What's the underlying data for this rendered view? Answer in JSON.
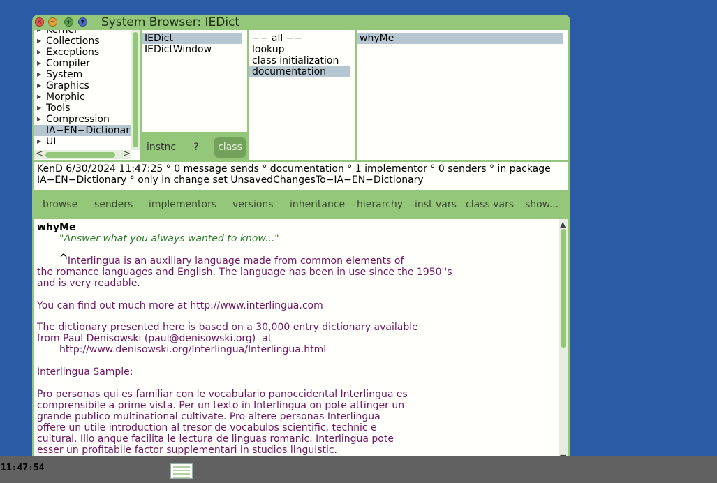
{
  "window": {
    "title": "System Browser: IEDict",
    "controls": {
      "close": "×",
      "minimize": "−",
      "maximize": "+",
      "menu": "▾"
    }
  },
  "categories": {
    "partial_top": "Kernel",
    "items": [
      "Collections",
      "Exceptions",
      "Compiler",
      "System",
      "Graphics",
      "Morphic",
      "Tools",
      "Compression",
      "IA−EN−Dictionary",
      "UI"
    ],
    "selected": "IA−EN−Dictionary"
  },
  "classes": {
    "items": [
      "IEDict",
      "IEDictWindow"
    ],
    "selected": "IEDict",
    "buttons": {
      "instance": "instnc",
      "help": "?",
      "class": "class"
    }
  },
  "protocols": {
    "items": [
      "−− all −−",
      "lookup",
      "class initialization",
      "documentation"
    ],
    "selected": "documentation"
  },
  "methods": {
    "items": [
      "whyMe"
    ],
    "selected": "whyMe"
  },
  "info": {
    "line1": "KenD 6/30/2024 11:47:25 ° 0 message sends ° documentation ° 1 implementor ° 0 senders ° in package",
    "line2": "IA−EN−Dictionary ° only in change set UnsavedChangesTo−IA−EN−Dictionary"
  },
  "toolbar": {
    "browse": "browse",
    "senders": "senders",
    "implementors": "implementors",
    "versions": "versions",
    "inheritance": "inheritance",
    "hierarchy": "hierarchy",
    "inst_vars": "inst vars",
    "class_vars": "class vars",
    "show": "show..."
  },
  "code": {
    "header": "whyMe",
    "comment": "\"Answer what you always wanted to know...\"",
    "caret": "^",
    "l1": "'Interlingua is an auxiliary language made from common elements of",
    "l2": "the romance languages and English. The language has been in use since the 1950''s",
    "l3": "and is very readable.",
    "l4": "You can find out much more at http://www.interlingua.com",
    "l5": "The dictionary presented here is based on a 30,000 entry dictionary available",
    "l6": "from Paul Denisowski (paul@denisowski.org)  at",
    "l7": "http://www.denisowski.org/Interlingua/Interlingua.html",
    "l8": "Interlingua Sample:",
    "l9": "Pro personas qui es familiar con le vocabulario panoccidental Interlingua es",
    "l10": "comprensibile a prime vista. Per un texto in Interlingua on pote attinger un",
    "l11": "grande publico multinational cultivate. Pro altere personas Interlingua",
    "l12": "offere un utile introduction al tresor de vocabulos scientific, technic e",
    "l13": "cultural. Illo anque facilita le lectura de linguas romanic. Interlingua pote",
    "l14": "esser un profitabile factor supplementari in studios linguistic."
  },
  "taskbar": {
    "clock": "11:47:54"
  },
  "colors": {
    "desktop": "#2a5ba4",
    "window": "#94c77a",
    "selection": "#b6c7d1",
    "code_text": "#6d1660",
    "comment": "#2a7a2a"
  }
}
